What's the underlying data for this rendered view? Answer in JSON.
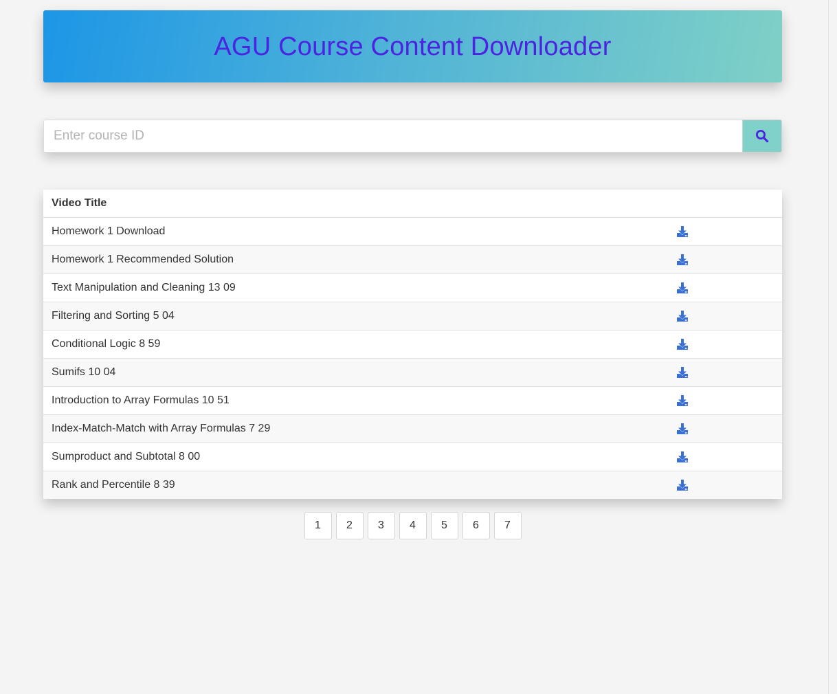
{
  "header": {
    "title": "AGU Course Content Downloader",
    "title_color": "#4a24df"
  },
  "search": {
    "placeholder": "Enter course ID",
    "value": "",
    "button_icon": "search-icon",
    "button_color": "#80d1c9"
  },
  "table": {
    "column_header": "Video Title",
    "download_icon": "download-icon",
    "accent_color": "#3a6fd3",
    "rows": [
      {
        "title": "Homework 1 Download"
      },
      {
        "title": "Homework 1 Recommended Solution"
      },
      {
        "title": "Text Manipulation and Cleaning 13 09"
      },
      {
        "title": "Filtering and Sorting 5 04"
      },
      {
        "title": "Conditional Logic 8 59"
      },
      {
        "title": "Sumifs 10 04"
      },
      {
        "title": "Introduction to Array Formulas 10 51"
      },
      {
        "title": "Index-Match-Match with Array Formulas 7 29"
      },
      {
        "title": "Sumproduct and Subtotal 8 00"
      },
      {
        "title": "Rank and Percentile 8 39"
      }
    ]
  },
  "pagination": {
    "pages": [
      "1",
      "2",
      "3",
      "4",
      "5",
      "6",
      "7"
    ]
  }
}
